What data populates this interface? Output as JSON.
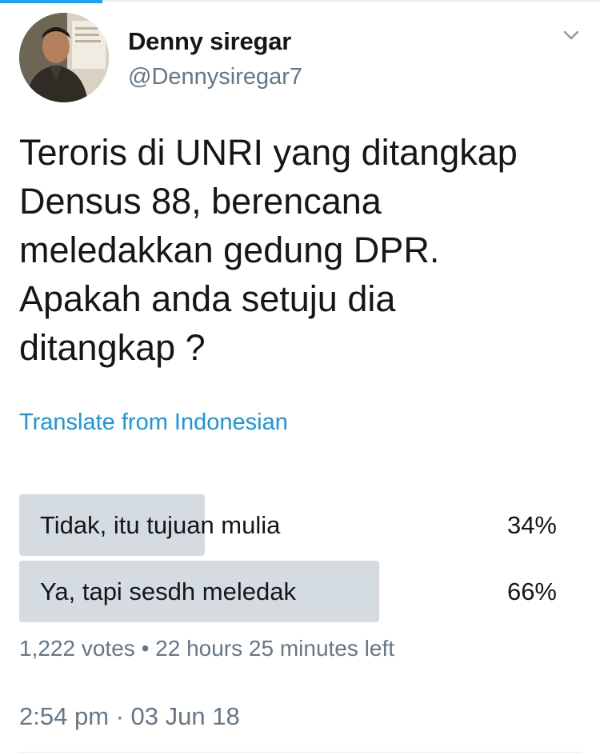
{
  "user": {
    "name": "Denny siregar",
    "handle": "@Dennysiregar7"
  },
  "tweet": {
    "lines": [
      "Teroris di UNRI yang ditangkap",
      "Densus 88, berencana",
      "meledakkan gedung DPR.",
      "Apakah anda setuju dia",
      "ditangkap ?"
    ],
    "translate_label": "Translate from Indonesian"
  },
  "poll": {
    "options": [
      {
        "label": "Tidak, itu tujuan mulia",
        "percent_text": "34%",
        "fraction": 0.34
      },
      {
        "label": "Ya, tapi sesdh meledak",
        "percent_text": "66%",
        "fraction": 0.66
      }
    ],
    "votes": "1,222 votes",
    "separator": "•",
    "time_left": "22 hours 25 minutes left"
  },
  "timestamp": "2:54 pm · 03 Jun 18",
  "icons": {
    "menu": "chevron-down-icon"
  },
  "colors": {
    "accent": "#1da1f2",
    "link": "#1b95e0",
    "secondary_text": "#657786",
    "poll_bar": "#ccd6dd"
  }
}
